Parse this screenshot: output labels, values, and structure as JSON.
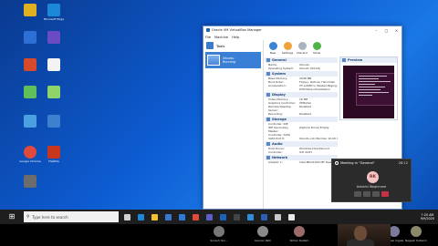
{
  "desktop_icons": [
    {
      "label": "",
      "color": "#e0b020"
    },
    {
      "label": "Microsoft Edge",
      "color": "#1b88d8"
    },
    {
      "label": "",
      "color": "#2e6fd6"
    },
    {
      "label": "",
      "color": "#6a4bc3"
    },
    {
      "label": "",
      "color": "#d84a2a"
    },
    {
      "label": "",
      "color": "#f3f3f3"
    },
    {
      "label": "",
      "color": "#5fbf5a"
    },
    {
      "label": "",
      "color": "#8fd46b"
    },
    {
      "label": "",
      "color": "#4aa0e0"
    },
    {
      "label": "",
      "color": "#3e7fd0"
    },
    {
      "label": "Google Chrome",
      "color": "#e04a3a"
    },
    {
      "label": "FileZilla",
      "color": "#c8361e"
    },
    {
      "label": "",
      "color": "#6c6c6c"
    }
  ],
  "vbox": {
    "title": "Oracle VM VirtualBox Manager",
    "menu": [
      "File",
      "Machine",
      "Help"
    ],
    "tools_label": "Tools",
    "vm_name": "Ubuntu",
    "vm_state": "Running",
    "toolbar": [
      {
        "label": "New",
        "color": "#3a83d5"
      },
      {
        "label": "Settings",
        "color": "#f0a33a"
      },
      {
        "label": "Discard",
        "color": "#a9b3bf"
      },
      {
        "label": "Show",
        "color": "#4fb34a"
      }
    ],
    "sections": [
      {
        "title": "General",
        "rows": [
          [
            "Name:",
            "Ubuntu"
          ],
          [
            "Operating System:",
            "Ubuntu (64-bit)"
          ]
        ]
      },
      {
        "title": "System",
        "rows": [
          [
            "Base Memory:",
            "2048 MB"
          ],
          [
            "Boot Order:",
            "Floppy, Optical, Hard Disk"
          ],
          [
            "Acceleration:",
            "VT-x/AMD-V, Nested Paging,"
          ],
          [
            "",
            "KVM Paravirtualization"
          ]
        ]
      },
      {
        "title": "Display",
        "rows": [
          [
            "Video Memory:",
            "16 MB"
          ],
          [
            "Graphics Controller:",
            "VMSVGA"
          ],
          [
            "Remote Desktop Server:",
            "Disabled"
          ],
          [
            "Recording:",
            "Disabled"
          ]
        ]
      },
      {
        "title": "Storage",
        "rows": [
          [
            "Controller: IDE",
            ""
          ],
          [
            "IDE Secondary Master:",
            "[Optical Drive] Empty"
          ],
          [
            "Controller: SATA",
            ""
          ],
          [
            "SATA Port 0:",
            "Ubuntu.vdi (Normal, 10.00 GB)"
          ]
        ]
      },
      {
        "title": "Audio",
        "rows": [
          [
            "Host Driver:",
            "Windows DirectSound"
          ],
          [
            "Controller:",
            "ICH AC97"
          ]
        ]
      },
      {
        "title": "Network",
        "rows": [
          [
            "Adapter 1:",
            "Intel PRO/1000 MT Desktop (NAT)"
          ]
        ]
      }
    ],
    "preview_title": "Preview"
  },
  "taskbar": {
    "search_placeholder": "Type here to search",
    "icons": [
      {
        "name": "task-view",
        "color": "#d0d0d0"
      },
      {
        "name": "edge",
        "color": "#1b88d8"
      },
      {
        "name": "file-explorer",
        "color": "#f0c030"
      },
      {
        "name": "store",
        "color": "#3a78d0"
      },
      {
        "name": "mail",
        "color": "#2f7ad6"
      },
      {
        "name": "chrome",
        "color": "#e04a3a"
      },
      {
        "name": "teams",
        "color": "#5b5fc7"
      },
      {
        "name": "virtualbox",
        "color": "#1b62b7"
      },
      {
        "name": "terminal",
        "color": "#444444"
      },
      {
        "name": "app",
        "color": "#2e8fd8"
      },
      {
        "name": "word",
        "color": "#2b5fb3"
      },
      {
        "name": "app2",
        "color": "#c8c8c8"
      },
      {
        "name": "app3",
        "color": "#e8e8e8"
      }
    ],
    "time": "7:20 AM",
    "date": "9/9/2020"
  },
  "meeting": {
    "title": "Meeting in \"General\"",
    "duration": "28:12",
    "initials": "RK",
    "participant": "Ashwini Waghmare"
  },
  "participants": [
    {
      "name": "Suresh Yan...",
      "color": "#777777"
    },
    {
      "name": "Gaurav Patil",
      "color": "#8a8a8a"
    },
    {
      "name": "Rohan Kadam",
      "color": "#9a6a6a"
    },
    {
      "name": "Manasi Ingale",
      "color": "#7a7a9a"
    },
    {
      "name": "Nagesh Kulkarni",
      "color": "#8a8a6a"
    }
  ]
}
